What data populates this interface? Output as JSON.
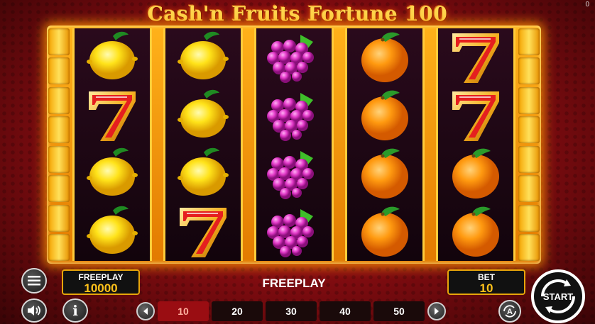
{
  "game": {
    "title": "Cash'n Fruits Fortune 100",
    "counter": "0"
  },
  "reels": [
    [
      "lemon",
      "seven",
      "lemon",
      "lemon"
    ],
    [
      "lemon",
      "lemon",
      "lemon",
      "seven"
    ],
    [
      "grapes",
      "grapes",
      "grapes",
      "grapes"
    ],
    [
      "orange",
      "orange",
      "orange",
      "orange"
    ],
    [
      "seven",
      "seven",
      "orange",
      "orange"
    ]
  ],
  "balance": {
    "label": "FREEPLAY",
    "value": "10000"
  },
  "status": {
    "message": "FREEPLAY"
  },
  "bet": {
    "label": "BET",
    "value": "10"
  },
  "lines": {
    "options": [
      "10",
      "20",
      "30",
      "40",
      "50"
    ],
    "selected": "10"
  },
  "controls": {
    "menu_icon": "hamburger-menu-icon",
    "sound_icon": "speaker-icon",
    "info_icon": "info-icon",
    "autoplay_icon": "autoplay-icon",
    "start_label": "START"
  },
  "colors": {
    "accent": "#ffc21a",
    "frame": "#f5a300",
    "background": "#b3141a"
  }
}
